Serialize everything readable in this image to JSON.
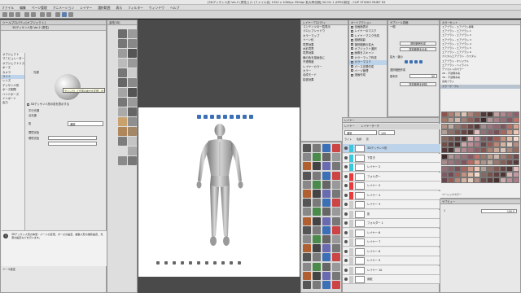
{
  "app": {
    "title": "[3Dデッサン人形 Ver.2 (男性)] (1 (ファイル名) 1920 x 1080px 350dpi 拡大率/回転 50.0% 1 (DPIの設定 - CLIP STUDIO PAINT EX"
  },
  "menu": [
    "ファイル",
    "編集",
    "ページ管理",
    "アニメーション",
    "レイヤー",
    "選択範囲",
    "表示",
    "フィルター",
    "ウィンドウ",
    "ヘルプ"
  ],
  "tool_property": {
    "title": "ツールプロパティ[オブジェクト]",
    "subtool_title": "3Dデッサン人形 Ver.2 (男性)",
    "tree_items": [
      "オブジェクト",
      "マニピュレーター",
      "オブジェクトリスト",
      "ポーズ",
      "カメラ",
      "ライト",
      "レンズ",
      "デッサン人形",
      "ポーズ制限",
      "ハンドポーズ",
      "インポート",
      "出力"
    ],
    "sections": {
      "body_shape": "体型",
      "pose": "ポーズ",
      "lights": "光源"
    },
    "checkbox_label": "3Dデッサン人形の影を表示する",
    "fields": [
      {
        "label": "光源",
        "value": ""
      },
      {
        "label": "平行光源",
        "value": ""
      },
      {
        "label": "点光源",
        "value": ""
      },
      {
        "label": "影",
        "value": "通常",
        "tooltip": "クリックして光源の向きを変更します"
      },
      {
        "label": "環境光色",
        "value": ""
      },
      {
        "label": "環境光色",
        "value": ""
      },
      {
        "label": "不透明度",
        "value": "100"
      }
    ],
    "tooltip": "クリックして光源の向きを変更します",
    "footer": "3Dデッサン人形の体型・パーツの変更、ポーズの設定、複数人形の撮影設定、光源の設定などを行います。",
    "bottom": "ツール設定"
  },
  "material": {
    "title": "素材[3D]",
    "items": [
      "すべての素材",
      "カラーパターン",
      "モノクロパターン",
      "画像素材",
      "3D",
      "キャラクター",
      "オブジェクト",
      "背景",
      "ポーズ",
      "全身",
      "手"
    ]
  },
  "canvas": {
    "subtitle": "1"
  },
  "layer_property": {
    "title": "レイヤープロパティ",
    "tabs": [
      "ナビゲーター",
      "サブビュー",
      "レイヤー"
    ],
    "items": [
      "コンテンツの一覧表示",
      "ドロップシャドウ",
      "カラーマップ",
      "トーン化",
      "境界効果",
      "水彩境界",
      "境界効果",
      "線の色を描画色に",
      "不透明度",
      "レイヤーカラー",
      "カラー",
      "合成モード",
      "拡張効果"
    ]
  },
  "auto_action": {
    "title": "オートアクション",
    "items": [
      "全画面表示",
      "レイヤーのマスク",
      "レイヤーマスク作成",
      "連続撮影",
      "選択範囲の拡大",
      "オブジェクト選択",
      "画像をスキャン",
      "カラーマップ作成",
      "カラーマスク",
      "パース定規作成",
      "ページ管理",
      "漫画作成"
    ]
  },
  "sub_tool": {
    "title": "サブツール詳細",
    "labels": [
      "一般",
      "選択範囲の拡大",
      "拡大・縮小",
      "拡大縮小",
      "選択範囲作成",
      "基本形",
      "拡大"
    ],
    "angle": "90",
    "btn_a": "選択範囲作成",
    "btn_b": "選択範囲を反転",
    "btn_c": "選択範囲を削除"
  },
  "color_set": {
    "title": "カラーセット",
    "items": [
      "エアブラシ - エアブラシ標準",
      "エアブラシ - エアブラシ 1",
      "エアブラシ - エアブラシ 2",
      "エアブラシ - エアブラシ 3",
      "エアブラシ - エアブラシ 4",
      "エアブラシ - エアブラシ 5",
      "エアブラシ - エアブラシ 6",
      "カスタムエアブラシ - カスタム",
      "エアブラシ - オリジナル",
      "エアブラシ - ハイライト",
      "デフォルトのカラー",
      "2D - 不透明水彩",
      "3D - 不透明水彩",
      "合成ブラシ",
      "カラーサークル"
    ],
    "selected_index": 14,
    "palette_title": "カラーセット",
    "palette_footer": "ベーシックカラー"
  },
  "layer_panel": {
    "title": "レイヤー",
    "tabs": [
      "レイヤー",
      "レイヤーサーチ"
    ],
    "blend": "通常",
    "opacity": "100",
    "options": [
      "ライト",
      "色調",
      "影",
      "ライト"
    ],
    "layers": [
      {
        "name": "3Dデッサン人形",
        "selected": true
      },
      {
        "name": "下書き",
        "selected": false
      },
      {
        "name": "レイヤー 2",
        "selected": false
      },
      {
        "name": "フォルダー",
        "selected": false
      },
      {
        "name": "レイヤー 5",
        "selected": false
      },
      {
        "name": "レイヤー 4",
        "selected": false
      },
      {
        "name": "レイヤー 3",
        "selected": false
      },
      {
        "name": "影",
        "selected": false
      },
      {
        "name": "フォルダー 1",
        "selected": false
      },
      {
        "name": "レイヤー 6",
        "selected": false
      },
      {
        "name": "レイヤー 7",
        "selected": false
      },
      {
        "name": "レイヤー 8",
        "selected": false
      },
      {
        "name": "レイヤー 9",
        "selected": false
      },
      {
        "name": "レイヤー 10",
        "selected": false
      },
      {
        "name": "用紙",
        "selected": false
      }
    ]
  },
  "timeline": {
    "title": "サブビュー",
    "label": "1",
    "value": "100.0"
  },
  "colors": {
    "swatch_red": "#e83b3b",
    "swatch_cyan": "#3cc8dc",
    "selection": "#bcd3ea",
    "canvas_bg": "#ffffff",
    "workspace_bg": "#4a4a4a",
    "panel_bg": "#e6e6e6"
  }
}
